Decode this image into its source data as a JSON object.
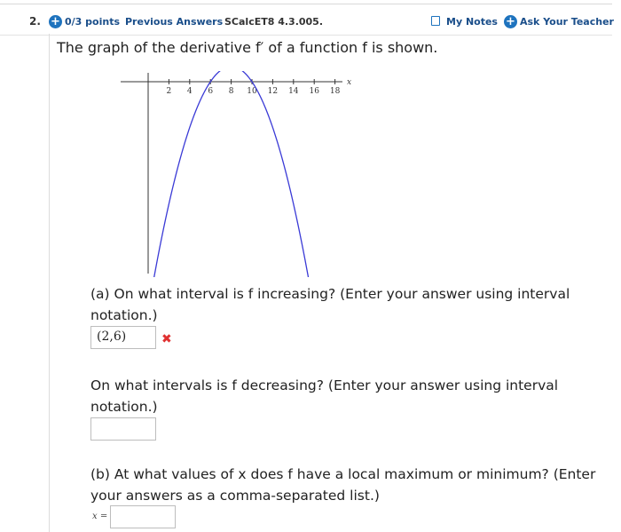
{
  "header": {
    "question_number": "2.",
    "points": "0/3 points",
    "previous_answers": "Previous Answers",
    "reference": "SCalcET8 4.3.005.",
    "my_notes": "My Notes",
    "ask_teacher": "Ask Your Teacher"
  },
  "stem": "The graph of the derivative f′ of a function f is shown.",
  "graph": {
    "axis_label_x": "x",
    "tick_labels": [
      "2",
      "4",
      "6",
      "8",
      "10",
      "12",
      "14",
      "16",
      "18"
    ],
    "curve_color": "#3a3ad6",
    "endpoint_color": "#2a2ad0",
    "curve_description": "downward parabola crossing x-axis at 6 and 10"
  },
  "part_a": {
    "question_increasing": "(a) On what interval is f increasing? (Enter your answer using interval notation.)",
    "increasing_answer": "(2,6)",
    "increasing_status": "✖",
    "question_decreasing": "On what intervals is f decreasing? (Enter your answer using interval notation.)",
    "decreasing_answer": ""
  },
  "part_b": {
    "question": "(b) At what values of x does f have a local maximum or minimum? (Enter your answers as a comma-separated list.)",
    "x_label": "x =",
    "answer": ""
  },
  "colors": {
    "link": "#1a4e8a",
    "accent": "#1e73be",
    "error": "#e03131"
  }
}
